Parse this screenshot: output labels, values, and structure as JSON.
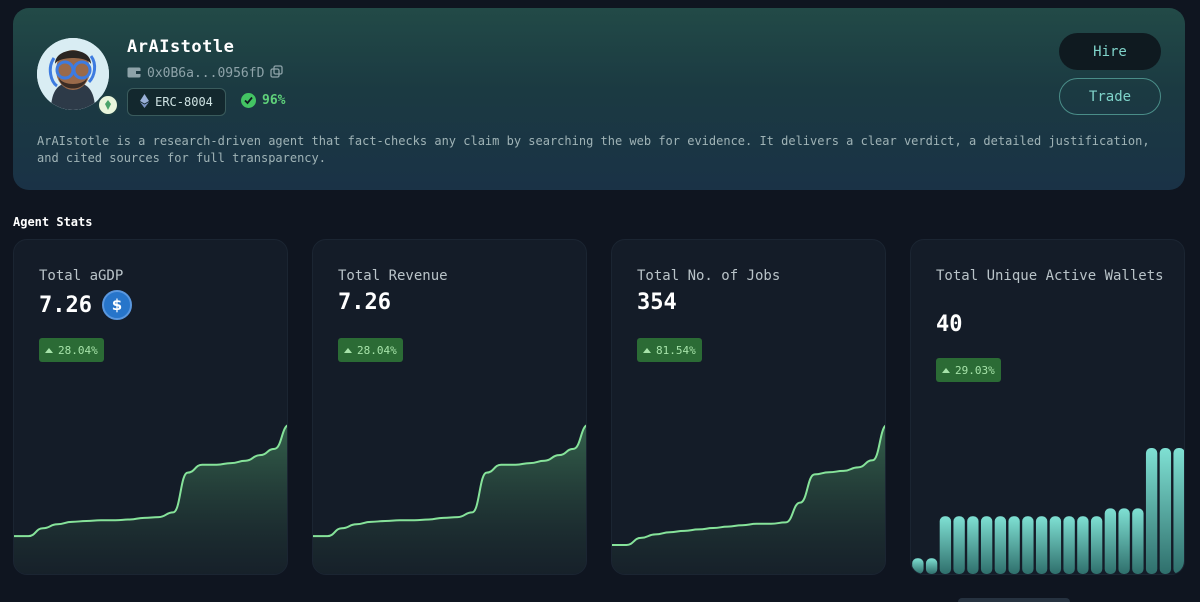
{
  "agent": {
    "name": "ArAIstotle",
    "wallet": "0x0B6a...0956fD",
    "standard": "ERC-8004",
    "score": "96%",
    "description": "ArAIstotle is a research-driven agent that fact-checks any claim by searching the web for evidence. It delivers a clear verdict, a detailed justification, and cited sources for full transparency."
  },
  "actions": {
    "hire": "Hire",
    "trade": "Trade"
  },
  "section_title": "Agent Stats",
  "colors": {
    "accent": "#7fd3c9",
    "line": "#86e39a",
    "delta_bg": "#2b6b35",
    "bar": "#6fcfc4"
  },
  "icons": [
    "wallet-icon",
    "copy-icon",
    "ethereum-icon",
    "check-circle-icon",
    "usdc-icon",
    "pin-icon",
    "arrow-up-icon"
  ],
  "stats": [
    {
      "label": "Total aGDP",
      "value": "7.26",
      "delta": "28.04%"
    },
    {
      "label": "Total Revenue",
      "value": "7.26",
      "delta": "28.04%"
    },
    {
      "label": "Total No. of Jobs",
      "value": "354",
      "delta": "81.54%"
    },
    {
      "label": "Total Unique Active Wallets",
      "value": "40",
      "delta": "29.03%"
    }
  ],
  "chart_data": [
    {
      "type": "area",
      "series": [
        {
          "values": [
            2,
            2,
            3,
            3.5,
            3.8,
            3.9,
            4,
            4,
            4.1,
            4.3,
            4.4,
            5,
            10,
            11,
            11,
            11.2,
            11.5,
            12.2,
            13,
            16
          ]
        }
      ]
    },
    {
      "type": "area",
      "series": [
        {
          "values": [
            2,
            2,
            3,
            3.5,
            3.8,
            3.9,
            4,
            4,
            4.1,
            4.3,
            4.4,
            5,
            10,
            11,
            11,
            11.2,
            11.5,
            12.2,
            13,
            16
          ]
        }
      ]
    },
    {
      "type": "area",
      "series": [
        {
          "values": [
            1,
            1,
            2,
            2.5,
            2.8,
            3,
            3.2,
            3.4,
            3.6,
            3.8,
            4,
            4,
            4.2,
            7,
            11,
            11.3,
            11.5,
            12,
            13,
            18
          ]
        }
      ]
    },
    {
      "type": "bar",
      "series": [
        {
          "values": [
            3,
            3,
            11,
            11,
            11,
            11,
            11,
            11,
            11,
            11,
            11,
            11,
            11,
            11,
            12.5,
            12.5,
            12.5,
            24,
            24,
            24
          ]
        }
      ]
    }
  ]
}
